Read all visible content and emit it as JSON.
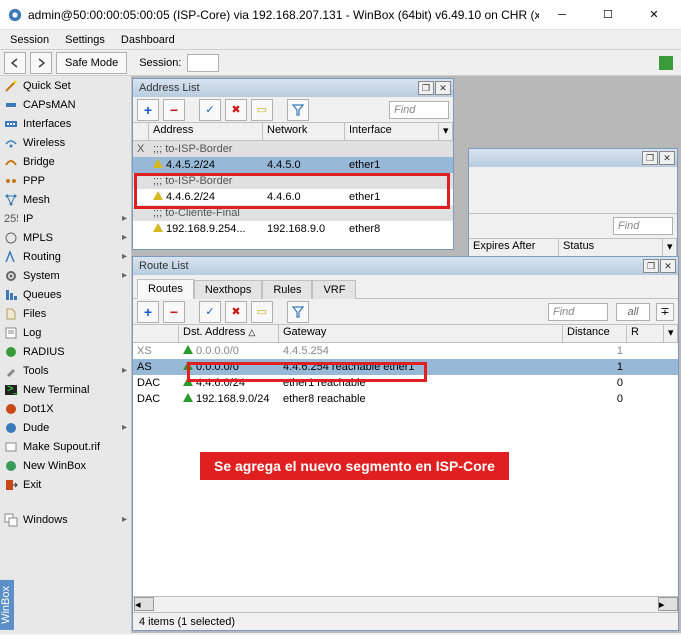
{
  "title": "admin@50:00:00:05:00:05 (ISP-Core) via 192.168.207.131 - WinBox (64bit) v6.49.10 on CHR (x86_64)",
  "menubar": [
    "Session",
    "Settings",
    "Dashboard"
  ],
  "safe_mode": "Safe Mode",
  "session_label": "Session:",
  "sidebar": [
    {
      "label": "Quick Set",
      "icon": "wand",
      "chev": false
    },
    {
      "label": "CAPsMAN",
      "icon": "cap",
      "chev": false
    },
    {
      "label": "Interfaces",
      "icon": "iface",
      "chev": false
    },
    {
      "label": "Wireless",
      "icon": "wifi",
      "chev": false
    },
    {
      "label": "Bridge",
      "icon": "bridge",
      "chev": false
    },
    {
      "label": "PPP",
      "icon": "ppp",
      "chev": false
    },
    {
      "label": "Mesh",
      "icon": "mesh",
      "chev": false
    },
    {
      "label": "IP",
      "icon": "ip",
      "chev": true
    },
    {
      "label": "MPLS",
      "icon": "mpls",
      "chev": true
    },
    {
      "label": "Routing",
      "icon": "routing",
      "chev": true
    },
    {
      "label": "System",
      "icon": "gear",
      "chev": true
    },
    {
      "label": "Queues",
      "icon": "queues",
      "chev": false
    },
    {
      "label": "Files",
      "icon": "files",
      "chev": false
    },
    {
      "label": "Log",
      "icon": "log",
      "chev": false
    },
    {
      "label": "RADIUS",
      "icon": "radius",
      "chev": false
    },
    {
      "label": "Tools",
      "icon": "tools",
      "chev": true
    },
    {
      "label": "New Terminal",
      "icon": "terminal",
      "chev": false
    },
    {
      "label": "Dot1X",
      "icon": "dot1x",
      "chev": false
    },
    {
      "label": "Dude",
      "icon": "dude",
      "chev": true
    },
    {
      "label": "Make Supout.rif",
      "icon": "supout",
      "chev": false
    },
    {
      "label": "New WinBox",
      "icon": "winbox",
      "chev": false
    },
    {
      "label": "Exit",
      "icon": "exit",
      "chev": false
    }
  ],
  "windows_item": "Windows",
  "winbox_tab": "WinBox",
  "addr_win": {
    "title": "Address List",
    "find": "Find",
    "cols": {
      "address": "Address",
      "network": "Network",
      "interface": "Interface"
    },
    "rows": [
      {
        "comment": ";;; to-ISP-Border",
        "addr": "4.4.5.2/24",
        "net": "4.4.5.0",
        "if": "ether1",
        "dim": true
      },
      {
        "comment": ";;; to-ISP-Border",
        "addr": "4.4.6.2/24",
        "net": "4.4.6.0",
        "if": "ether1",
        "dim": false
      },
      {
        "comment": ";;; to-Cliente-Final",
        "addr": "192.168.9.254...",
        "net": "192.168.9.0",
        "if": "ether8",
        "dim": false
      }
    ]
  },
  "back_win": {
    "find": "Find",
    "cols": {
      "expires": "Expires After",
      "status": "Status"
    }
  },
  "route_win": {
    "title": "Route List",
    "tabs": [
      "Routes",
      "Nexthops",
      "Rules",
      "VRF"
    ],
    "find": "Find",
    "all": "all",
    "cols": {
      "dst": "Dst. Address",
      "gw": "Gateway",
      "dist": "Distance",
      "r": "R"
    },
    "rows": [
      {
        "flag": "XS",
        "dst": "0.0.0.0/0",
        "gw": "4.4.5.254",
        "dist": "1",
        "dim": true,
        "tri": "g"
      },
      {
        "flag": "AS",
        "dst": "0.0.0.0/0",
        "gw": "4.4.6.254 reachable ether1",
        "dist": "1",
        "sel": true,
        "tri": "g"
      },
      {
        "flag": "DAC",
        "dst": "4.4.6.0/24",
        "gw": "ether1 reachable",
        "dist": "0",
        "tri": "g"
      },
      {
        "flag": "DAC",
        "dst": "192.168.9.0/24",
        "gw": "ether8 reachable",
        "dist": "0",
        "tri": "g"
      }
    ],
    "status": "4 items (1 selected)"
  },
  "annotation": "Se agrega el nuevo segmento en ISP-Core"
}
